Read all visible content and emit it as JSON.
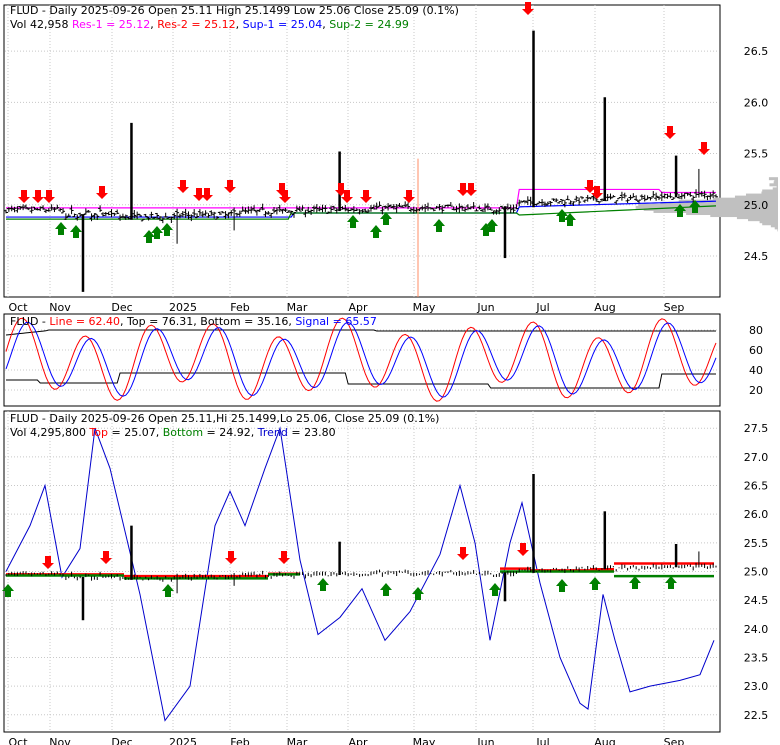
{
  "colors": {
    "background": "#ffffff",
    "frame": "#000000",
    "grid": "#c8c8c8",
    "price_bar": "#000000",
    "res1": "#ff00ff",
    "res2": "#ff0000",
    "sup1": "#0000ff",
    "sup2": "#008000",
    "line": "#ff0000",
    "signal": "#0000ff",
    "band": "#000000",
    "trend": "#0000cc",
    "top": "#ff0000",
    "bottom": "#008000",
    "up_arrow": "#008000",
    "down_arrow": "#ff0000",
    "volume_profile": "#c0c0c0",
    "marker": "#ff8c66"
  },
  "chart_data": [
    {
      "type": "ohlc",
      "panel": "price",
      "title_parts": [
        {
          "text": "FLUD - Daily 2025-09-26 Open 25.11  High 25.1499  Low 25.06  Close 25.09 (0.1%)",
          "color": "#000000"
        }
      ],
      "subtitle_parts": [
        {
          "text": "Vol 42,958 ",
          "color": "#000000"
        },
        {
          "text": "Res-1 = 25.12",
          "color": "#ff00ff"
        },
        {
          "text": ", ",
          "color": "#000000"
        },
        {
          "text": "Res-2 = 25.12",
          "color": "#ff0000"
        },
        {
          "text": ", ",
          "color": "#000000"
        },
        {
          "text": "Sup-1 = 25.04",
          "color": "#0000ff"
        },
        {
          "text": ", ",
          "color": "#000000"
        },
        {
          "text": "Sup-2 = 24.99",
          "color": "#008000"
        }
      ],
      "x_labels": [
        "Oct",
        "Nov",
        "Dec",
        "2025",
        "Feb",
        "Mar",
        "Apr",
        "May",
        "Jun",
        "Jul",
        "Aug",
        "Sep"
      ],
      "y_ticks": [
        "26.5",
        "26.0",
        "25.5",
        "25.0",
        "24.5"
      ],
      "ylim": [
        24.1,
        26.95
      ],
      "grid": true,
      "levels": {
        "res1": 25.12,
        "res2": 25.12,
        "sup1": 25.04,
        "sup2": 24.99
      }
    },
    {
      "type": "line",
      "panel": "stochastic",
      "title_parts": [
        {
          "text": "FLUD - ",
          "color": "#000000"
        },
        {
          "text": "Line = 62.40",
          "color": "#ff0000"
        },
        {
          "text": ", Top = 76.31, Bottom = 35.16, ",
          "color": "#000000"
        },
        {
          "text": "Signal = 65.57",
          "color": "#0000ff"
        }
      ],
      "y_ticks": [
        "80",
        "60",
        "40",
        "20"
      ],
      "ylim": [
        4,
        96
      ],
      "grid": true,
      "series": [
        {
          "name": "Line",
          "values": [
            62.4
          ]
        },
        {
          "name": "Top",
          "values": [
            76.31
          ]
        },
        {
          "name": "Bottom",
          "values": [
            35.16
          ]
        },
        {
          "name": "Signal",
          "values": [
            65.57
          ]
        }
      ]
    },
    {
      "type": "ohlc",
      "panel": "trend",
      "title_parts": [
        {
          "text": "FLUD - Daily 2025-09-26 Open 25.11,Hi 25.1499,Lo 25.06, Close 25.09 (0.1%)",
          "color": "#000000"
        }
      ],
      "subtitle_parts": [
        {
          "text": "Vol 4,295,800 ",
          "color": "#000000"
        },
        {
          "text": "Top",
          "color": "#ff0000"
        },
        {
          "text": " = 25.07, ",
          "color": "#000000"
        },
        {
          "text": "Bottom",
          "color": "#008000"
        },
        {
          "text": " = 24.92, ",
          "color": "#000000"
        },
        {
          "text": "Trend",
          "color": "#0000cc"
        },
        {
          "text": " = 23.80",
          "color": "#000000"
        }
      ],
      "x_labels": [
        "Oct",
        "Nov",
        "Dec",
        "2025",
        "Feb",
        "Mar",
        "Apr",
        "May",
        "Jun",
        "Jul",
        "Aug",
        "Sep"
      ],
      "y_ticks": [
        "27.5",
        "27.0",
        "26.5",
        "26.0",
        "25.5",
        "25.0",
        "24.5",
        "24.0",
        "23.5",
        "23.0",
        "22.5"
      ],
      "ylim": [
        22.2,
        27.8
      ],
      "grid": true,
      "levels": {
        "top": 25.07,
        "bottom": 24.92,
        "trend": 23.8
      }
    }
  ]
}
